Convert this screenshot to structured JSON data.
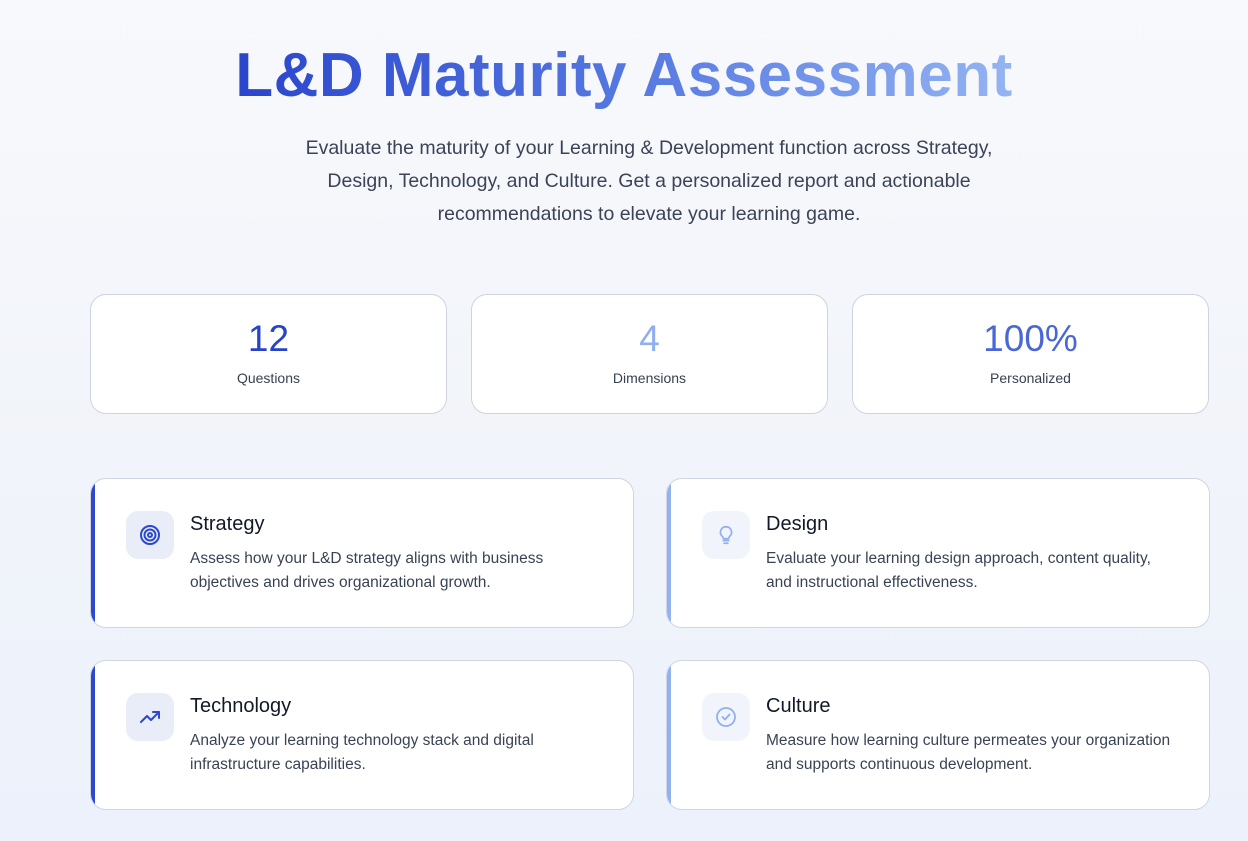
{
  "header": {
    "title": "L&D Maturity Assessment",
    "subtitle": "Evaluate the maturity of your Learning & Development function across Strategy, Design, Technology, and Culture. Get a personalized report and actionable recommendations to elevate your learning game."
  },
  "stats": [
    {
      "value": "12",
      "label": "Questions",
      "color": "#2744c9"
    },
    {
      "value": "4",
      "label": "Dimensions",
      "color": "#8fb0ef"
    },
    {
      "value": "100%",
      "label": "Personalized",
      "color": "#4a67d6"
    }
  ],
  "dimensions": [
    {
      "title": "Strategy",
      "description": "Assess how your L&D strategy aligns with business objectives and drives organizational growth.",
      "icon": "target-icon",
      "accent": "#2b48cf"
    },
    {
      "title": "Design",
      "description": "Evaluate your learning design approach, content quality, and instructional effectiveness.",
      "icon": "lightbulb-icon",
      "accent": "#93b1ee"
    },
    {
      "title": "Technology",
      "description": "Analyze your learning technology stack and digital infrastructure capabilities.",
      "icon": "trending-up-icon",
      "accent": "#2b48cf"
    },
    {
      "title": "Culture",
      "description": "Measure how learning culture permeates your organization and supports continuous development.",
      "icon": "check-circle-icon",
      "accent": "#93b1ee"
    }
  ]
}
